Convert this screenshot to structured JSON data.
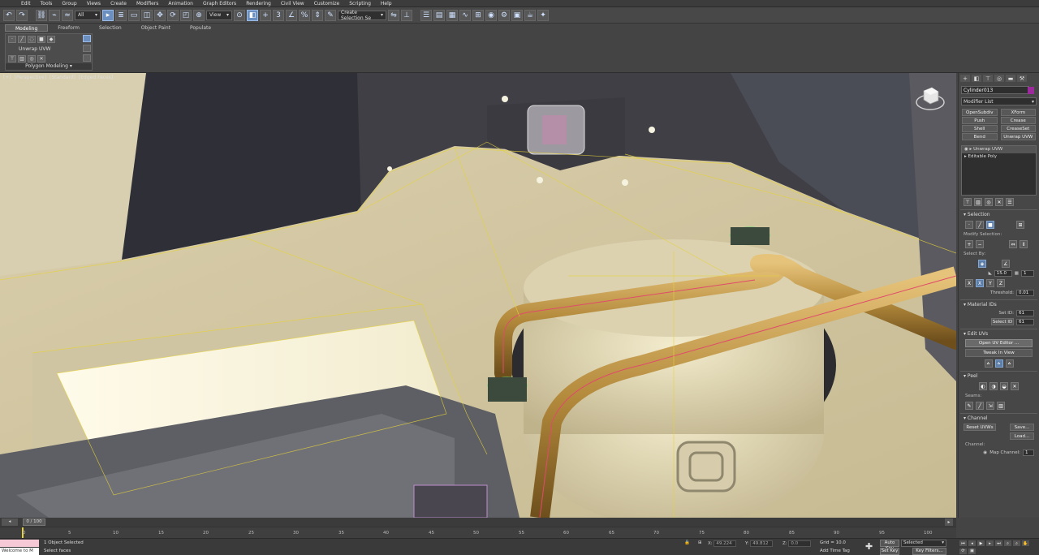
{
  "menu": [
    "Edit",
    "Tools",
    "Group",
    "Views",
    "Create",
    "Modifiers",
    "Animation",
    "Graph Editors",
    "Rendering",
    "Civil View",
    "Customize",
    "Scripting",
    "Help"
  ],
  "toolbar": {
    "selection_filter": "All",
    "ref_coord": "View",
    "named_selection": "Create Selection Se"
  },
  "ribbon": {
    "tabs": [
      "Modeling",
      "Freeform",
      "Selection",
      "Object Paint",
      "Populate"
    ],
    "active_tab": "Modeling",
    "modifier": "Unwrap UVW",
    "footer": "Polygon Modeling"
  },
  "viewport": {
    "label": [
      "[+]",
      "[Perspective]",
      "[Standard]",
      "[Edged Faces]"
    ]
  },
  "command_panel": {
    "object_name": "Cylinder013",
    "modifier_list": "Modifier List",
    "modifier_buttons": [
      "OpenSubdiv",
      "XForm",
      "Push",
      "Crease",
      "Shell",
      "CreaseSet",
      "Bend",
      "Unwrap UVW"
    ],
    "stack": [
      "Unwrap UVW",
      "Editable Poly"
    ],
    "selection": {
      "title": "Selection",
      "modify_label": "Modify Selection:",
      "select_by": "Select By:",
      "angle": "15.0",
      "threshold_label": "Threshold:",
      "threshold": "0.01",
      "loop_count": "1"
    },
    "material_ids": {
      "title": "Material IDs",
      "set_id_label": "Set ID:",
      "set_id": "61",
      "select_id": "Select ID",
      "select_id_value": "61"
    },
    "edit_uvs": {
      "title": "Edit UVs",
      "open_editor": "Open UV Editor ...",
      "tweak": "Tweak In View"
    },
    "peel": {
      "title": "Peel",
      "seams": "Seams:"
    },
    "channel": {
      "title": "Channel",
      "reset": "Reset UVWs",
      "save": "Save...",
      "load": "Load...",
      "channel_label": "Channel:",
      "map_channel": "Map Channel:",
      "map_value": "1"
    }
  },
  "timeline": {
    "slider": "0 / 100",
    "ticks": [
      "0",
      "5",
      "10",
      "15",
      "20",
      "25",
      "30",
      "35",
      "40",
      "45",
      "50",
      "55",
      "60",
      "65",
      "70",
      "75",
      "80",
      "85",
      "90",
      "95",
      "100"
    ]
  },
  "status": {
    "maxscript": "Welcome to M",
    "selected": "1 Object Selected",
    "prompt": "Select faces",
    "x_label": "X:",
    "x": "49.224",
    "y_label": "Y:",
    "y": "49.812",
    "z_label": "Z:",
    "z": "0.0",
    "grid": "Grid = 10.0",
    "add_time_tag": "Add Time Tag",
    "auto_key": "Auto Key",
    "set_key": "Set Key",
    "key_mode": "Selected",
    "key_filters": "Key Filters..."
  },
  "colors": {
    "wire": "#e6d23a",
    "pipe": "#b58a3a",
    "selection_highlight": "#e04b6b",
    "object_color": "#9c2a9c"
  }
}
